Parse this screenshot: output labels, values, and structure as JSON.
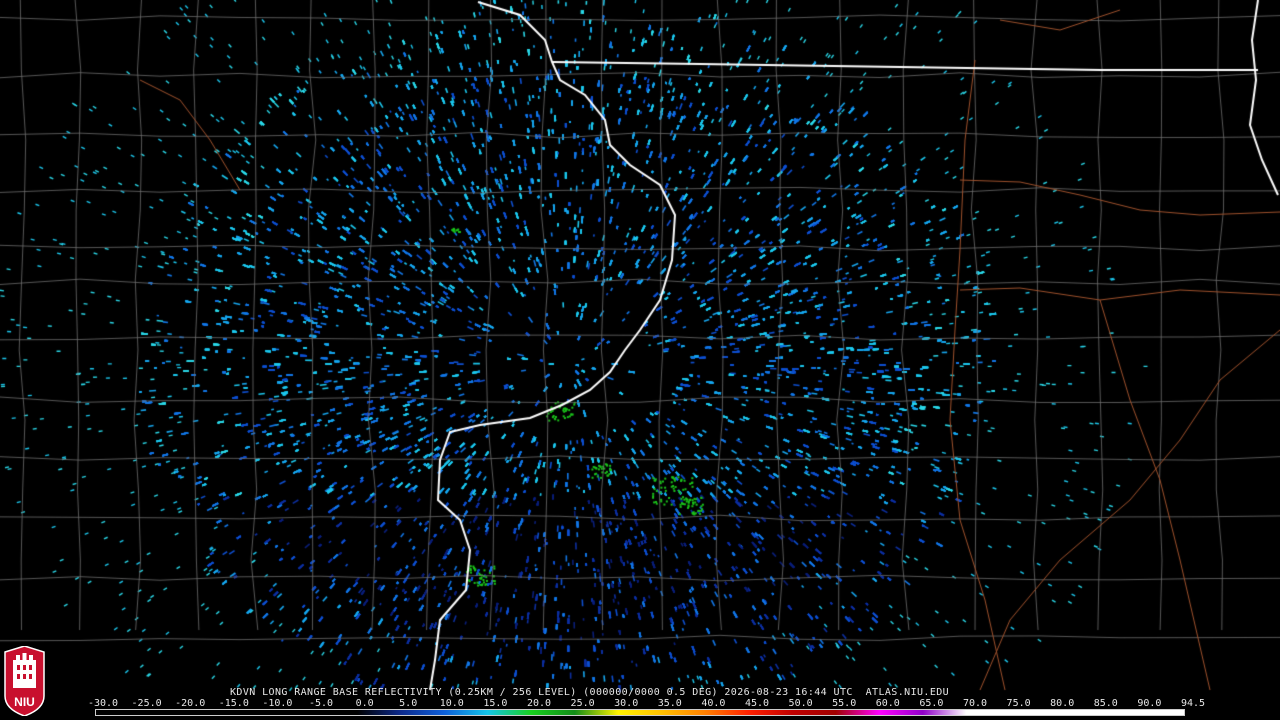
{
  "product": {
    "header": "KDVN LONG RANGE BASE REFLECTIVITY (0.25KM / 256 LEVEL) (000000/0000 0.5 DEG) 2026-08-23 16:44 UTC  ATLAS.NIU.EDU"
  },
  "logo": {
    "text": "NIU",
    "icon": "niu-tower-logo",
    "color": "#c8102e"
  },
  "color_scale": {
    "ticks": [
      "-30.0",
      "-25.0",
      "-20.0",
      "-15.0",
      "-10.0",
      "-5.0",
      "0.0",
      "5.0",
      "10.0",
      "15.0",
      "20.0",
      "25.0",
      "30.0",
      "35.0",
      "40.0",
      "45.0",
      "50.0",
      "55.0",
      "60.0",
      "65.0",
      "70.0",
      "75.0",
      "80.0",
      "85.0",
      "90.0",
      "94.5"
    ],
    "values": [
      -30,
      -25,
      -20,
      -15,
      -10,
      -5,
      0,
      5,
      10,
      15,
      20,
      25,
      30,
      35,
      40,
      45,
      50,
      55,
      60,
      65,
      70,
      75,
      80,
      85,
      90,
      94.5
    ],
    "colors": [
      "#000000",
      "#000000",
      "#000000",
      "#000000",
      "#000000",
      "#000000",
      "#000000",
      "#0d2a8c",
      "#0e5fd8",
      "#14c4e8",
      "#18d01f",
      "#138c18",
      "#fff200",
      "#ffc000",
      "#ff7f00",
      "#ff2000",
      "#c00000",
      "#a00000",
      "#ff00ff",
      "#9000c8",
      "#ffffff",
      "#ffffff",
      "#ffffff",
      "#ffffff",
      "#ffffff",
      "#ffffff"
    ]
  },
  "map": {
    "radar_site": "KDVN",
    "echo_colors": [
      "#0a1e78",
      "#0d2fa0",
      "#0e4fd0",
      "#1276e6",
      "#16a6ee",
      "#1cc8ee",
      "#2ad8e8"
    ],
    "green_echo_color": "#1ac21a",
    "county_line_color": "#6e6e6e",
    "state_line_color": "#ffffff",
    "road_color": "#a0522d"
  }
}
